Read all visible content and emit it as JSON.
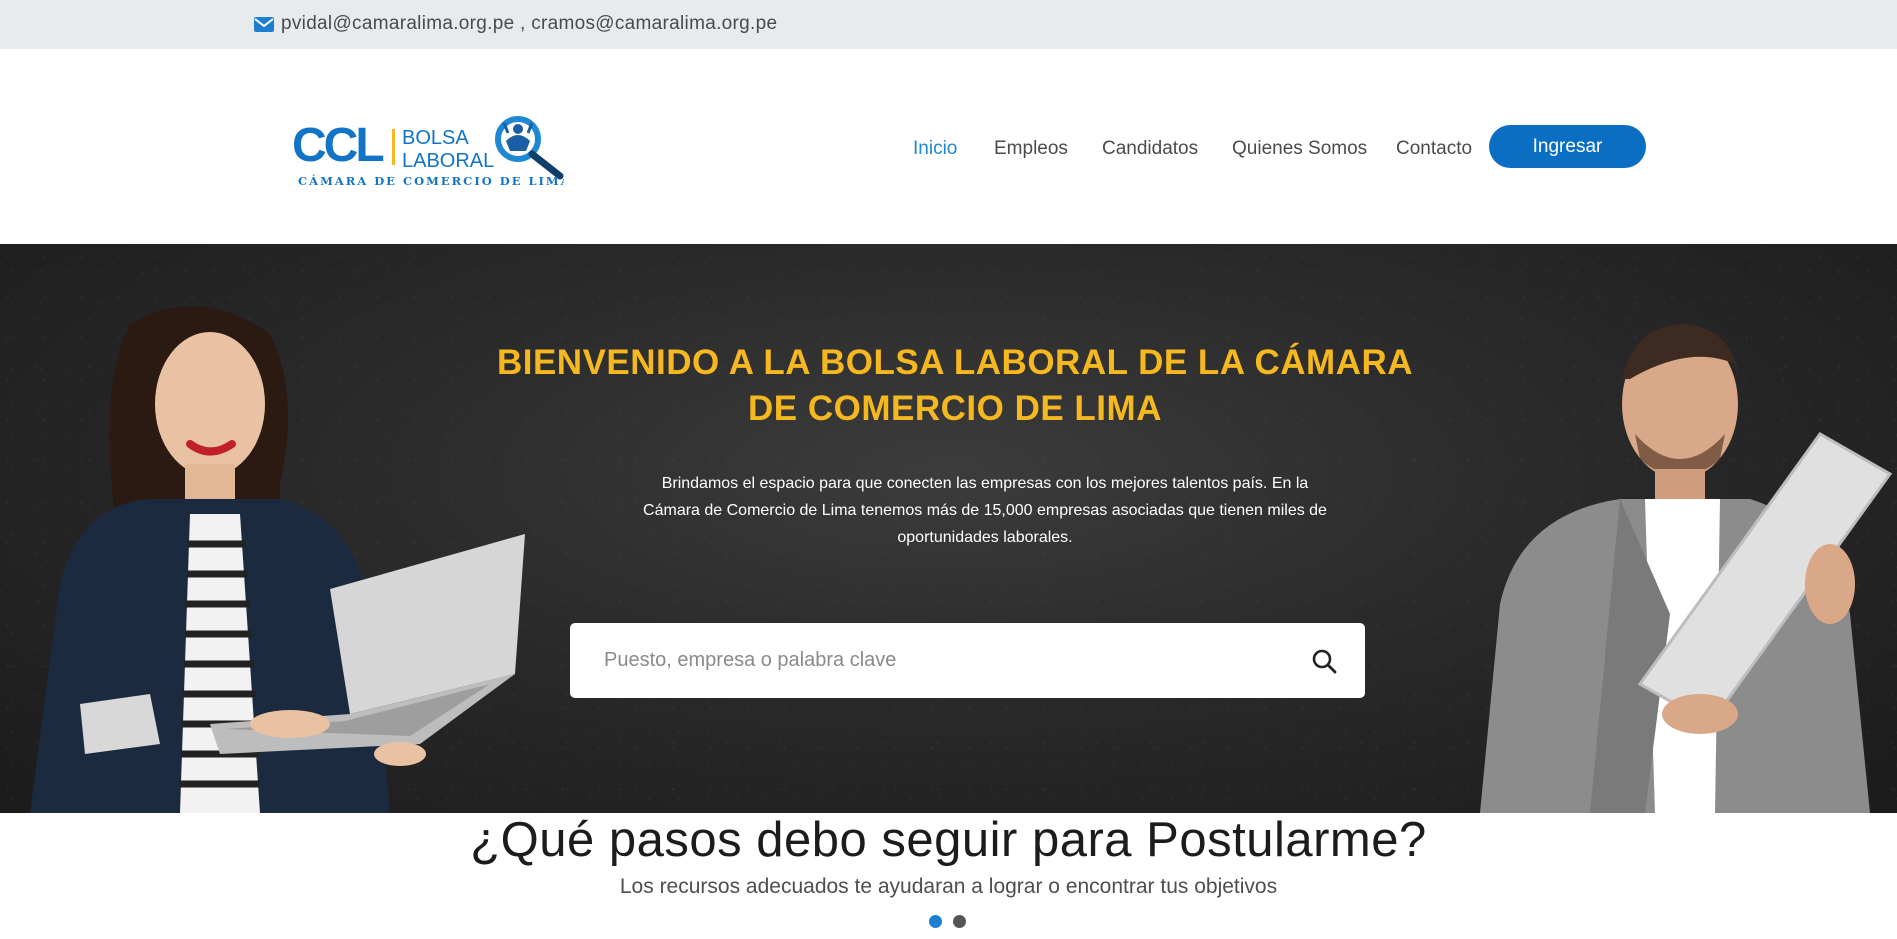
{
  "topbar": {
    "email_icon": "envelope-icon",
    "emails": "pvidal@camaralima.org.pe , cramos@camaralima.org.pe"
  },
  "logo": {
    "brand": "CCL",
    "line1": "BOLSA",
    "line2": "LABORAL",
    "tagline": "CÁMARA DE COMERCIO DE LIMA"
  },
  "nav": {
    "items": [
      {
        "label": "Inicio",
        "active": true
      },
      {
        "label": "Empleos",
        "active": false
      },
      {
        "label": "Candidatos",
        "active": false
      },
      {
        "label": "Quienes Somos",
        "active": false
      },
      {
        "label": "Contacto",
        "active": false
      }
    ],
    "login_label": "Ingresar"
  },
  "hero": {
    "title": "BIENVENIDO A LA BOLSA LABORAL DE LA CÁMARA DE COMERCIO DE LIMA",
    "subtitle": "Brindamos el espacio para que conecten las empresas con los mejores talentos país. En la Cámara de Comercio de Lima tenemos más de 15,000 empresas asociadas que tienen miles de oportunidades laborales.",
    "search_placeholder": "Puesto, empresa o palabra clave",
    "search_value": ""
  },
  "steps": {
    "title": "¿Qué pasos debo seguir para Postularme?",
    "subtitle": "Los recursos adecuados te ayudaran a lograr o encontrar tus objetivos",
    "carousel_active_index": 0,
    "carousel_count": 2
  },
  "colors": {
    "accent": "#0a6fc2",
    "nav_active": "#1e88d3",
    "hero_title": "#f5b820",
    "topbar_bg": "#e8ebee"
  }
}
